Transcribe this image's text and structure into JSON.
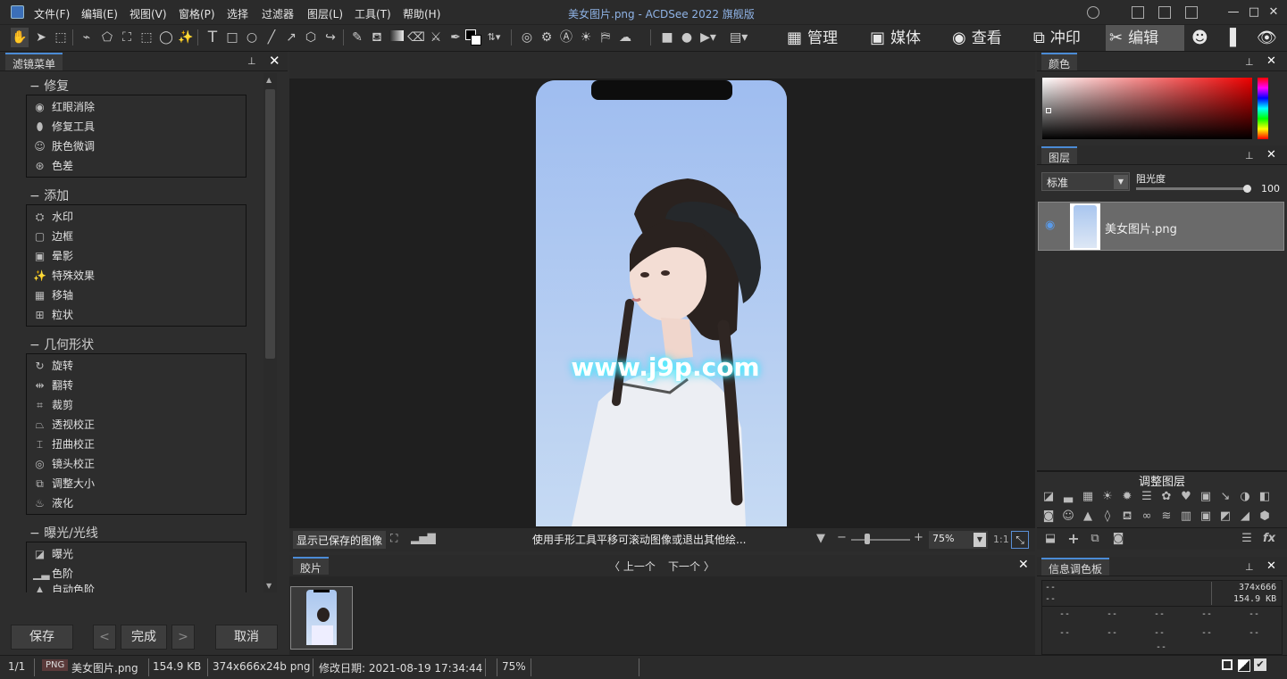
{
  "window": {
    "title": "美女图片.png - ACDSee 2022 旗舰版",
    "menu": [
      "文件(F)",
      "编辑(E)",
      "视图(V)",
      "窗格(P)",
      "选择",
      "过滤器",
      "图层(L)",
      "工具(T)",
      "帮助(H)"
    ]
  },
  "modes": [
    "管理",
    "媒体",
    "查看",
    "冲印",
    "编辑"
  ],
  "filter_panel": {
    "tab": "滤镜菜单",
    "groups": [
      {
        "title": "修复",
        "items": [
          "红眼消除",
          "修复工具",
          "肤色微调",
          "色差"
        ]
      },
      {
        "title": "添加",
        "items": [
          "水印",
          "边框",
          "晕影",
          "特殊效果",
          "移轴",
          "粒状"
        ]
      },
      {
        "title": "几何形状",
        "items": [
          "旋转",
          "翻转",
          "裁剪",
          "透视校正",
          "扭曲校正",
          "镜头校正",
          "调整大小",
          "液化"
        ]
      },
      {
        "title": "曝光/光线",
        "items": [
          "曝光",
          "色阶",
          "自动色阶"
        ]
      }
    ],
    "buttons": {
      "save": "保存",
      "prev": "<",
      "done": "完成",
      "next": ">",
      "cancel": "取消"
    }
  },
  "canvas": {
    "watermark": "www.j9p.com",
    "show_saved": "显示已保存的图像",
    "hint": "使用手形工具平移可滚动图像或退出其他绘...",
    "zoom": "75%",
    "ratio": "1:1"
  },
  "filmstrip": {
    "tab": "胶片",
    "prev": "上一个",
    "next": "下一个"
  },
  "color_panel": {
    "tab": "颜色"
  },
  "layers_panel": {
    "tab": "图层",
    "blend_mode": "标准",
    "opacity_label": "阻光度",
    "opacity": "100",
    "opacity_level": 1.0,
    "layer_name": "美女图片.png"
  },
  "adjust_layers": {
    "title": "调整图层"
  },
  "info_panel": {
    "tab": "信息调色板",
    "dims": "374x666",
    "size": "154.9 KB",
    "placeholder": "--"
  },
  "status": {
    "index": "1/1",
    "format": "PNG",
    "filename": "美女图片.png",
    "filesize": "154.9 KB",
    "dimensions": "374x666x24b png",
    "modified": "修改日期: 2021-08-19 17:34:44",
    "zoom": "75%"
  }
}
